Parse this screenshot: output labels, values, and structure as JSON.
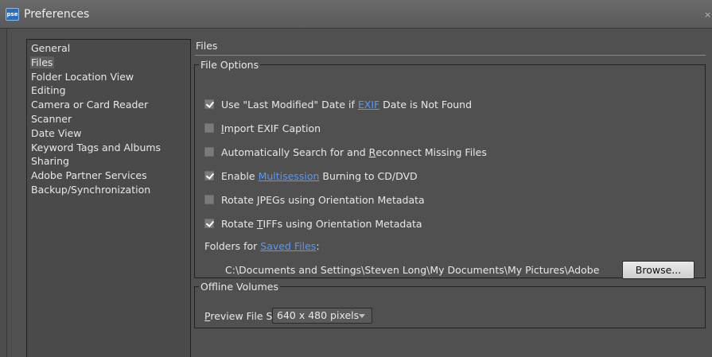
{
  "window": {
    "title": "Preferences",
    "app_icon_text": "pse",
    "close_glyph": "×"
  },
  "sidebar": {
    "items": [
      {
        "label": "General"
      },
      {
        "label": "Files"
      },
      {
        "label": "Folder Location View"
      },
      {
        "label": "Editing"
      },
      {
        "label": "Camera or Card Reader"
      },
      {
        "label": "Scanner"
      },
      {
        "label": "Date View"
      },
      {
        "label": "Keyword Tags and Albums"
      },
      {
        "label": "Sharing"
      },
      {
        "label": "Adobe Partner Services"
      },
      {
        "label": "Backup/Synchronization"
      }
    ],
    "selected": "Files"
  },
  "main": {
    "section_title": "Files",
    "file_options": {
      "legend": "File Options",
      "last_modified": {
        "before": "Use \"Last Modified\" Date if ",
        "link": "EXIF",
        "after": " Date is Not Found",
        "checked": true
      },
      "import_exif": {
        "ul": "I",
        "rest": "mport EXIF Caption",
        "checked": false
      },
      "auto_search": {
        "before": "Automatically Search for and ",
        "ul": "R",
        "after": "econnect Missing Files",
        "checked": false
      },
      "multisession": {
        "before": "Enable ",
        "link": "Multisession",
        "after": " Burning to CD/DVD",
        "checked": true
      },
      "rotate_jpegs": {
        "before": "Rotate ",
        "ul": "J",
        "after": "PEGs using Orientation Metadata",
        "checked": false
      },
      "rotate_tiffs": {
        "before": "Rotate ",
        "ul": "T",
        "after": "IFFs using Orientation Metadata",
        "checked": true
      },
      "folders_for": {
        "before": "Folders for ",
        "link": "Saved Files",
        "after": ":"
      },
      "saved_files_path": "C:\\Documents and Settings\\Steven Long\\My Documents\\My Pictures\\Adobe",
      "browse_label": "Browse..."
    },
    "offline_volumes": {
      "legend": "Offline Volumes",
      "preview_label_ul": "P",
      "preview_label_rest": "review File Size:",
      "preview_value": "640 x 480 pixels"
    }
  },
  "colors": {
    "background": "#4d4d4d",
    "link": "#4f9bff",
    "text": "#e8e8e8"
  }
}
